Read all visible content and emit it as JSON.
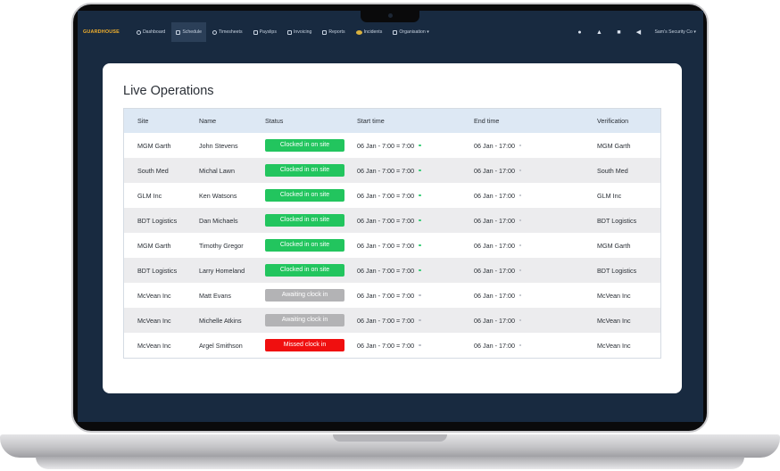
{
  "nav": {
    "brand": "GUARDHOUSE",
    "items": [
      {
        "label": "Dashboard",
        "icon": "dashboard-icon",
        "active": false
      },
      {
        "label": "Schedule",
        "icon": "calendar-icon",
        "active": true
      },
      {
        "label": "Timesheets",
        "icon": "clock-icon",
        "active": false
      },
      {
        "label": "Payslips",
        "icon": "payslip-icon",
        "active": false
      },
      {
        "label": "Invoicing",
        "icon": "invoice-icon",
        "active": false
      },
      {
        "label": "Reports",
        "icon": "report-icon",
        "active": false
      },
      {
        "label": "Incidents",
        "icon": "incident-badge-icon",
        "active": false
      },
      {
        "label": "Organisation ▾",
        "icon": "users-icon",
        "active": false
      }
    ],
    "right_icons": [
      "chat-icon",
      "graduation-cap-icon",
      "mail-icon",
      "megaphone-icon"
    ],
    "account": "Sam's Security Co ▾"
  },
  "page": {
    "title": "Live Operations"
  },
  "table": {
    "columns": [
      "Site",
      "Name",
      "Status",
      "Start time",
      "End time",
      "Verification"
    ],
    "rows": [
      {
        "site": "MGM Garth",
        "name": "John Stevens",
        "status": "Clocked in on site",
        "status_kind": "clocked",
        "start": "06 Jan - 7:00 = 7:00",
        "end": "06 Jan - 17:00",
        "verification": "MGM Garth"
      },
      {
        "site": "South Med",
        "name": "Michal Lawn",
        "status": "Clocked in on site",
        "status_kind": "clocked",
        "start": "06 Jan - 7:00 = 7:00",
        "end": "06 Jan - 17:00",
        "verification": "South Med"
      },
      {
        "site": "GLM Inc",
        "name": "Ken Watsons",
        "status": "Clocked in on site",
        "status_kind": "clocked",
        "start": "06 Jan - 7:00 = 7:00",
        "end": "06 Jan - 17:00",
        "verification": "GLM Inc"
      },
      {
        "site": "BDT Logistics",
        "name": "Dan Michaels",
        "status": "Clocked in on site",
        "status_kind": "clocked",
        "start": "06 Jan - 7:00 = 7:00",
        "end": "06 Jan - 17:00",
        "verification": "BDT Logistics"
      },
      {
        "site": "MGM Garth",
        "name": "Timothy Gregor",
        "status": "Clocked in on site",
        "status_kind": "clocked",
        "start": "06 Jan - 7:00 = 7:00",
        "end": "06 Jan - 17:00",
        "verification": "MGM Garth"
      },
      {
        "site": "BDT Logistics",
        "name": "Larry Homeland",
        "status": "Clocked in on site",
        "status_kind": "clocked",
        "start": "06 Jan - 7:00 = 7:00",
        "end": "06 Jan - 17:00",
        "verification": "BDT Logistics"
      },
      {
        "site": "McVean Inc",
        "name": "Matt Evans",
        "status": "Awaiting clock in",
        "status_kind": "awaiting",
        "start": "06 Jan - 7:00 = 7:00",
        "end": "06 Jan - 17:00",
        "verification": "McVean Inc"
      },
      {
        "site": "McVean Inc",
        "name": "Michelle Atkins",
        "status": "Awaiting clock in",
        "status_kind": "awaiting",
        "start": "06 Jan - 7:00 = 7:00",
        "end": "06 Jan - 17:00",
        "verification": "McVean Inc"
      },
      {
        "site": "McVean Inc",
        "name": "Argel Smithson",
        "status": "Missed clock in",
        "status_kind": "missed",
        "start": "06 Jan - 7:00 = 7:00",
        "end": "06 Jan - 17:00",
        "verification": "McVean Inc"
      }
    ]
  },
  "colors": {
    "brand": "#f2b02c",
    "nav_bg": "#182a40",
    "clocked": "#22c55e",
    "awaiting": "#b3b3b5",
    "missed": "#f00f0f",
    "header_bg": "#dde8f4"
  }
}
